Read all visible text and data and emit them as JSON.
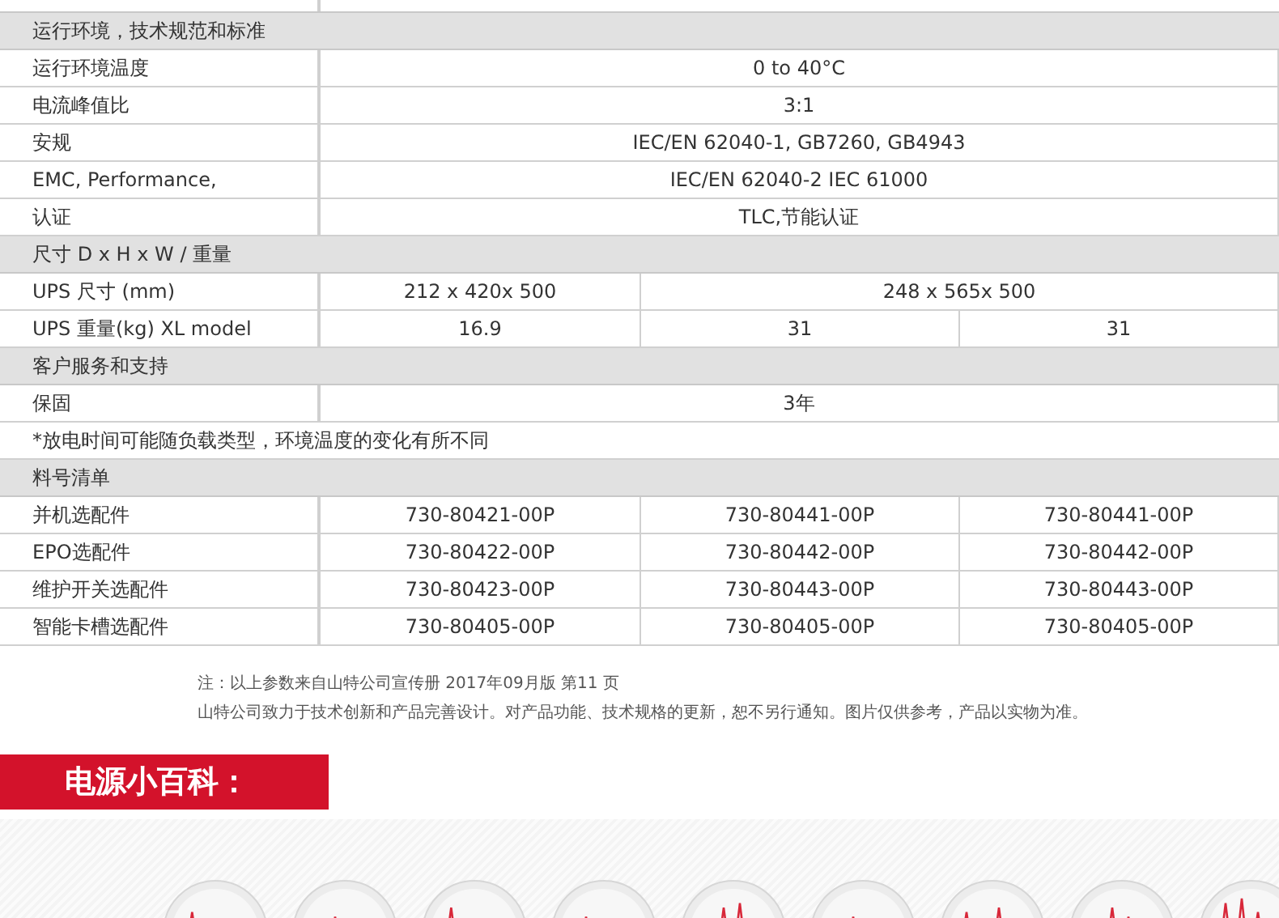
{
  "spec_table": {
    "rows": [
      {
        "kind": "section",
        "label": "运行环境，技术规范和标准"
      },
      {
        "kind": "row",
        "label": "运行环境温度",
        "cells": [
          "0 to 40°C"
        ]
      },
      {
        "kind": "row",
        "label": "电流峰值比",
        "cells": [
          "3:1"
        ]
      },
      {
        "kind": "row",
        "label": "安规",
        "cells": [
          "IEC/EN 62040-1, GB7260, GB4943"
        ]
      },
      {
        "kind": "row",
        "label": "EMC, Performance,",
        "cells": [
          "IEC/EN 62040-2  IEC 61000"
        ]
      },
      {
        "kind": "row",
        "label": "认证",
        "cells": [
          "TLC,节能认证"
        ]
      },
      {
        "kind": "section",
        "label": "尺寸 D x H x W / 重量"
      },
      {
        "kind": "row",
        "label": "UPS 尺寸 (mm)",
        "cells": [
          "212 x 420x 500",
          "248 x 565x 500"
        ]
      },
      {
        "kind": "row",
        "label": "UPS 重量(kg) XL model",
        "cells": [
          "16.9",
          "31",
          "31"
        ]
      },
      {
        "kind": "section",
        "label": "客户服务和支持"
      },
      {
        "kind": "row",
        "label": "保固",
        "cells": [
          "3年"
        ]
      },
      {
        "kind": "note",
        "label": "*放电时间可能随负载类型，环境温度的变化有所不同"
      },
      {
        "kind": "section",
        "label": "料号清单"
      },
      {
        "kind": "row",
        "label": "并机选配件",
        "cells": [
          "730-80421-00P",
          "730-80441-00P",
          "730-80441-00P"
        ]
      },
      {
        "kind": "row",
        "label": "EPO选配件",
        "cells": [
          "730-80422-00P",
          "730-80442-00P",
          "730-80442-00P"
        ]
      },
      {
        "kind": "row",
        "label": "维护开关选配件",
        "cells": [
          "730-80423-00P",
          "730-80443-00P",
          "730-80443-00P"
        ]
      },
      {
        "kind": "row",
        "label": "智能卡槽选配件",
        "cells": [
          "730-80405-00P",
          "730-80405-00P",
          "730-80405-00P"
        ]
      }
    ]
  },
  "footnotes": [
    "注：以上参数来自山特公司宣传册 2017年09月版 第11 页",
    "山特公司致力于技术创新和产品完善设计。对产品功能、技术规格的更新，恕不另行通知。图片仅供参考，产品以实物为准。"
  ],
  "banner": {
    "title": "电源小百科："
  }
}
